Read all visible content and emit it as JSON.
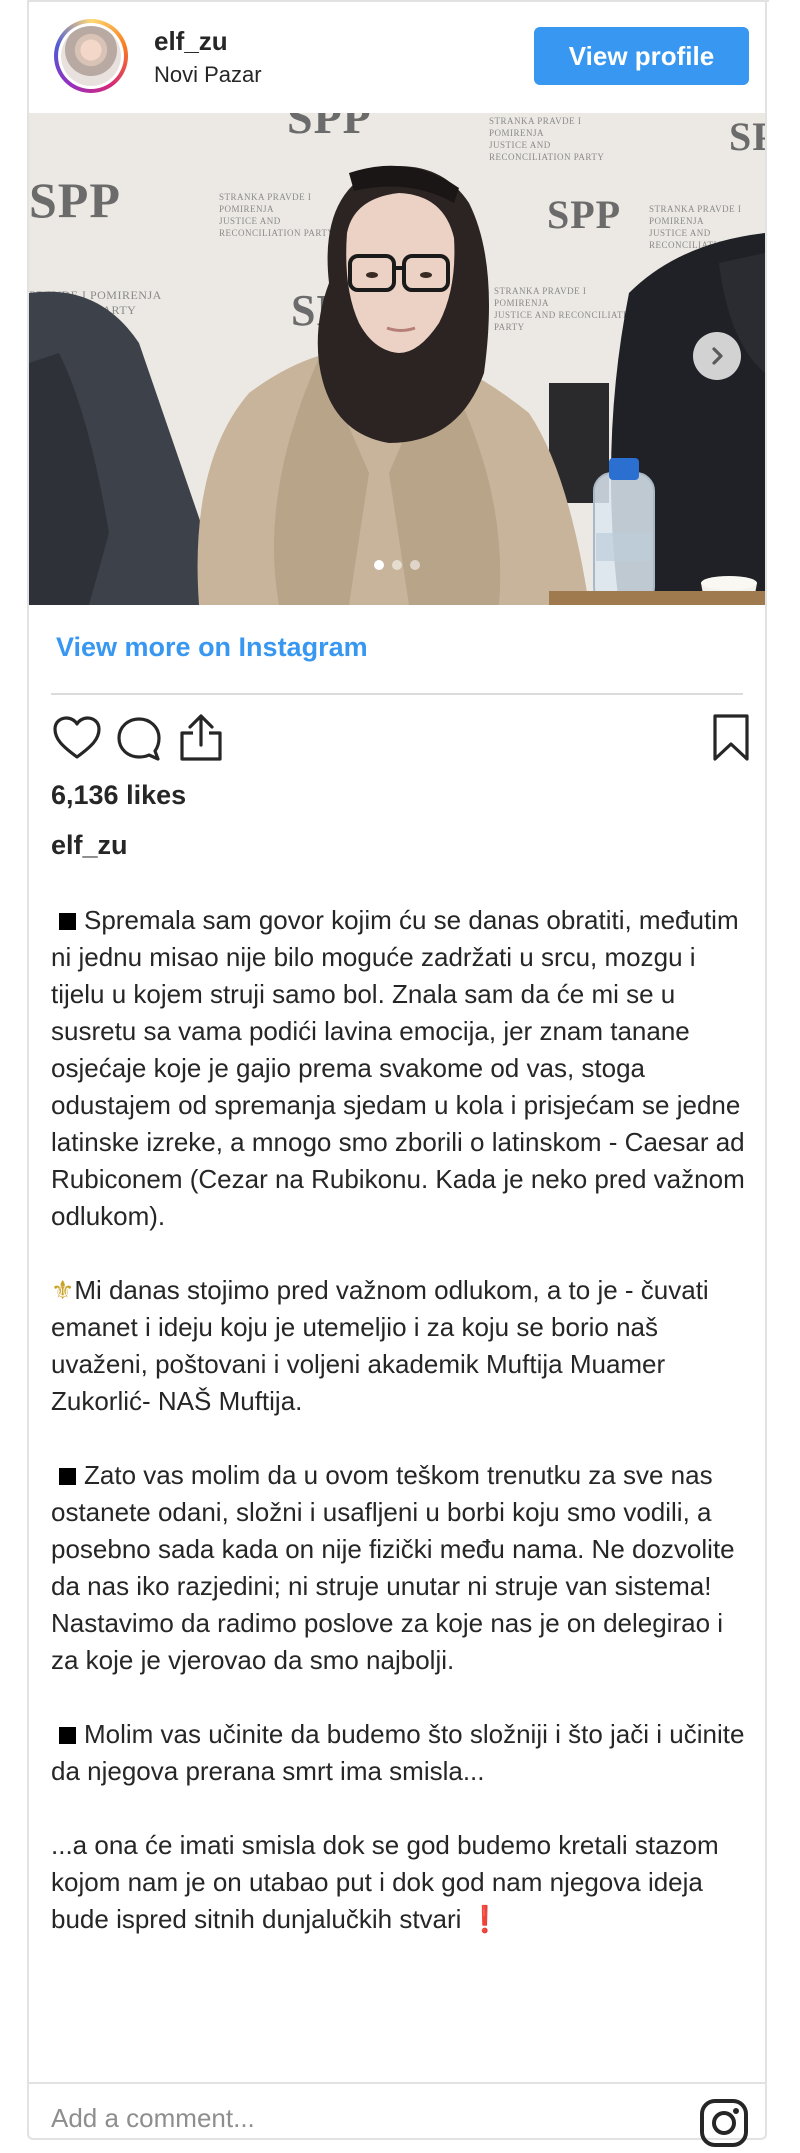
{
  "post": {
    "username": "elf_zu",
    "location": "Novi Pazar",
    "view_profile": "View profile",
    "view_more": "View more on Instagram",
    "likes": "6,136 likes",
    "caption_user": "elf_zu",
    "carousel": {
      "count": 3,
      "active_index": 0
    },
    "backdrop_text": {
      "logo": "SPP",
      "org_line1": "STRANKA PRAVDE I POMIRENJA",
      "org_line2": "JUSTICE AND RECONCILIATION PARTY",
      "org_fragment1": "PRAVDE I POMIRENJA",
      "org_fragment2": "CILIATION PARTY"
    },
    "comment_placeholder": "Add a comment..."
  },
  "caption": {
    "p1": "Spremala sam govor kojim ću se danas obratiti, međutim ni jednu misao nije bilo moguće zadržati u srcu, mozgu i tijelu u kojem struji samo bol. Znala sam da će mi se u susretu sa vama podići lavina emocija, jer znam tanane osjećaje koje je gajio prema svakome od vas, stoga odustajem od spremanja sjedam u kola i prisjećam se jedne latinske izreke, a mnogo smo zborili o latinskom - Caesar ad Rubiconem (Cezar na Rubikonu. Kada je neko pred važnom odlukom).",
    "p2_symbol": "⚜",
    "p2": "Mi danas stojimo pred važnom odlukom, a to je - čuvati emanet i ideju koju je utemeljio i za koju se borio naš uvaženi, poštovani i voljeni akademik Muftija Muamer Zukorlić- NAŠ Muftija.",
    "p3": "Zato vas molim da u ovom teškom trenutku za sve nas ostanete odani, složni i usafljeni u borbi koju smo vodili, a posebno sada kada on nije fizički među nama. Ne dozvolite da nas iko razjedini; ni struje unutar ni struje van sistema! Nastavimo da radimo poslove za koje nas je on delegirao i za koje je vjerovao da smo najbolji.",
    "p4": "Molim vas učinite da budemo što složniji i što jači i učinite da njegova prerana smrt ima smisla...",
    "p5": "...a ona će imati smisla dok se god budemo kretali stazom kojom nam je on utabao put i dok god nam njegova ideja bude ispred sitnih dunjalučkih stvari",
    "p5_end": "❗"
  },
  "icons": {
    "like": "heart-icon",
    "comment": "comment-icon",
    "share": "share-icon",
    "save": "bookmark-icon",
    "next": "chevron-right-icon",
    "instagram": "instagram-icon"
  },
  "colors": {
    "accent": "#3897f0",
    "text": "#262626",
    "muted": "#8e8e8e",
    "divider": "#dbdbdb"
  }
}
